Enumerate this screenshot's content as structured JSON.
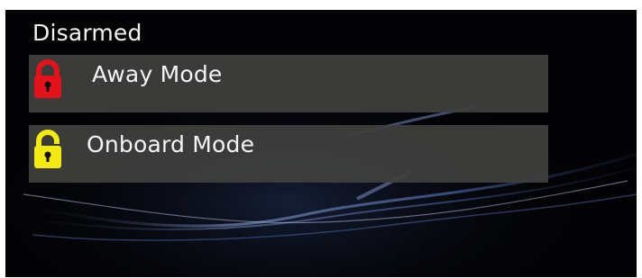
{
  "status": {
    "text": "Disarmed"
  },
  "modes": [
    {
      "label": "Away Mode",
      "icon": "locked-padlock-icon",
      "color": "#e3121b"
    },
    {
      "label": "Onboard Mode",
      "icon": "unlocked-padlock-icon",
      "color": "#f2ea10"
    }
  ],
  "colors": {
    "background": "#030305",
    "button": "#40403e",
    "text": "#f4f4f4",
    "wave": "#6f8fd0"
  }
}
